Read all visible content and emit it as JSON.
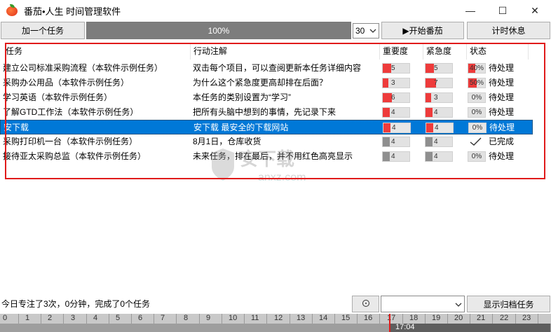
{
  "window": {
    "title": "番茄•人生 时间管理软件",
    "minimize": "—",
    "maximize": "☐",
    "close": "✕"
  },
  "toolbar": {
    "add_task": "加一个任务",
    "progress_text": "100%",
    "progress_value": 100,
    "minutes_value": "30",
    "start_tomato": "▶开始番茄",
    "timed_rest": "计时休息"
  },
  "table": {
    "headers": [
      "任务",
      "行动注解",
      "重要度",
      "紧急度",
      "状态"
    ],
    "rows": [
      {
        "task": "建立公司标准采购流程（本软件示例任务）",
        "note": "双击每个项目，可以查阅更新本任务详细内容",
        "importance": 5,
        "urgency": 5,
        "progress": "40%",
        "progress_value": 40,
        "status": "待处理"
      },
      {
        "task": "采购办公用品（本软件示例任务）",
        "note": "为什么这个紧急度更高却排在后面？",
        "importance": 3,
        "urgency": 7,
        "progress": "50%",
        "progress_value": 50,
        "status": "待处理"
      },
      {
        "task": "学习英语（本软件示例任务）",
        "note": "本任务的类别设置为“学习”",
        "importance": 6,
        "urgency": 3,
        "progress": "0%",
        "progress_value": 0,
        "status": "待处理"
      },
      {
        "task": "了解GTD工作法（本软件示例任务）",
        "note": "把所有头脑中想到的事情，先记录下来",
        "importance": 4,
        "urgency": 4,
        "progress": "0%",
        "progress_value": 0,
        "status": "待处理"
      },
      {
        "task": "安下载",
        "note": "安下载  最安全的下载网站",
        "importance": 4,
        "urgency": 4,
        "progress": "0%",
        "progress_value": 0,
        "status": "待处理"
      },
      {
        "task": "采购打印机一台（本软件示例任务）",
        "note": "8月1日，仓库收货",
        "importance": 4,
        "urgency": 4,
        "progress": "",
        "progress_value": 0,
        "status": "已完成"
      },
      {
        "task": "接待亚太采购总监（本软件示例任务）",
        "note": "未来任务，排在最后，并不用红色高亮显示",
        "importance": 4,
        "urgency": 4,
        "progress": "0%",
        "progress_value": 0,
        "status": "待处理"
      }
    ]
  },
  "watermark": {
    "text": "安下载",
    "sub": "anxz.com"
  },
  "bottom": {
    "summary": "今日专注了3次，0分钟，完成了0个任务",
    "show_archive": "显示归档任务",
    "clock_icon": "clock-icon"
  },
  "timeline": {
    "hours": [
      "0",
      "1",
      "2",
      "3",
      "4",
      "5",
      "6",
      "7",
      "8",
      "9",
      "10",
      "11",
      "12",
      "13",
      "14",
      "15",
      "16",
      "17",
      "18",
      "19",
      "20",
      "21",
      "22",
      "23"
    ],
    "current_time": "17:04"
  },
  "colors": {
    "accent": "#0078d7",
    "meter_red": "#ee3b3b",
    "outline_red": "#e01b1b"
  }
}
